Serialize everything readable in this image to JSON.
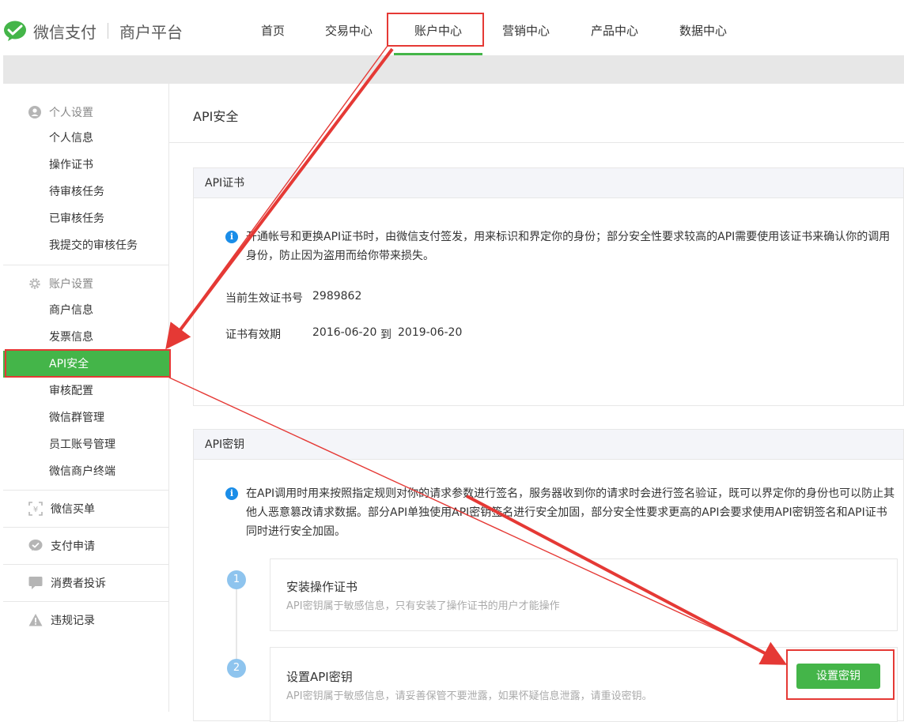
{
  "brand": {
    "name": "微信支付",
    "sub": "商户平台"
  },
  "nav": [
    "首页",
    "交易中心",
    "账户中心",
    "营销中心",
    "产品中心",
    "数据中心"
  ],
  "sidebar": {
    "personal_group": "个人设置",
    "personal_items": [
      "个人信息",
      "操作证书",
      "待审核任务",
      "已审核任务",
      "我提交的审核任务"
    ],
    "account_group": "账户设置",
    "account_items": [
      "商户信息",
      "发票信息",
      "API安全",
      "审核配置",
      "微信群管理",
      "员工账号管理",
      "微信商户终端"
    ],
    "wechat_buy": "微信买单",
    "pay_apply": "支付申请",
    "complaint": "消费者投诉",
    "violation": "违规记录"
  },
  "main": {
    "title": "API安全",
    "cert_panel": {
      "head": "API证书",
      "info_line1": "开通帐号和更换API证书时，由微信支付签发，用来标识和界定你的身份；部分安全性要求较高的API需要使用该证书来确认你的调用",
      "info_line2": "身份，防止因为盗用而给你带来损失。",
      "cert_no_label": "当前生效证书号",
      "cert_no_value": "2989862",
      "valid_label": "证书有效期",
      "valid_from": "2016-06-20",
      "valid_to_word": "到",
      "valid_to": "2019-06-20"
    },
    "key_panel": {
      "head": "API密钥",
      "info_line1": "在API调用时用来按照指定规则对你的请求参数进行签名，服务器收到你的请求时会进行签名验证，既可以界定你的身份也可以防止其",
      "info_line2": "他人恶意篡改请求数据。部分API单独使用API密钥签名进行安全加固，部分安全性要求更高的API会要求使用API密钥签名和API证书",
      "info_line3": "同时进行安全加固。",
      "step1_no": "1",
      "step1_title": "安装操作证书",
      "step1_desc": "API密钥属于敏感信息，只有安装了操作证书的用户才能操作",
      "step2_no": "2",
      "step2_title": "设置API密钥",
      "step2_desc": "API密钥属于敏感信息，请妥善保管不要泄露，如果怀疑信息泄露，请重设密钥。",
      "set_key_button": "设置密钥"
    }
  },
  "colors": {
    "green": "#44b549",
    "highlight": "#e53935",
    "info": "#1a8de8"
  }
}
